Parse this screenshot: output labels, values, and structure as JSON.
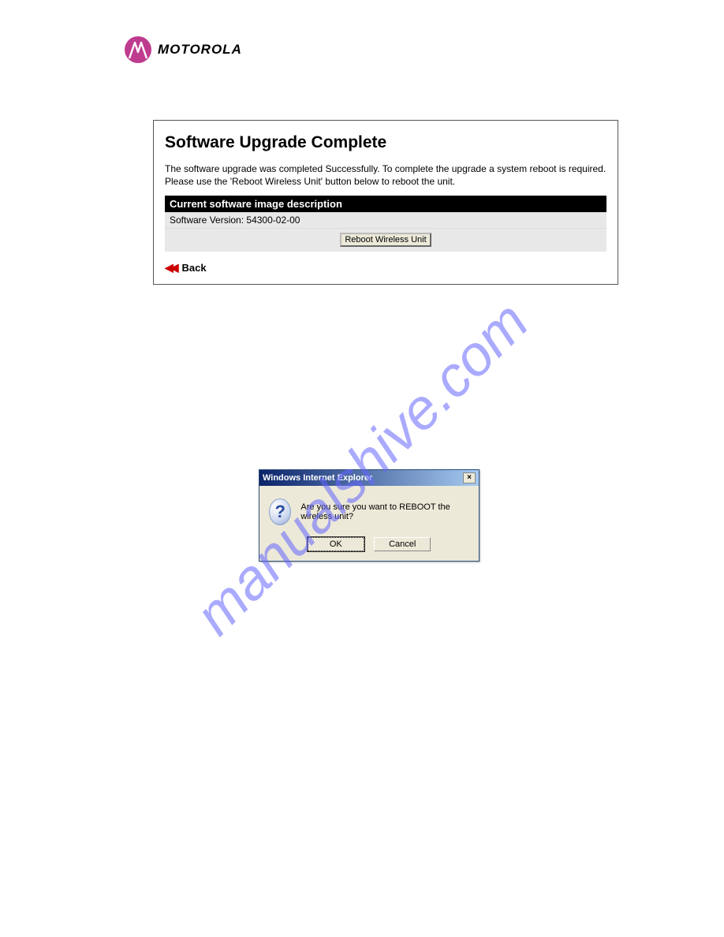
{
  "brand": {
    "name": "MOTOROLA"
  },
  "watermark": "manualshive.com",
  "panel": {
    "title": "Software Upgrade Complete",
    "description": "The software upgrade was completed Successfully. To complete the upgrade a system reboot is required. Please use the 'Reboot Wireless Unit' button below to reboot the unit.",
    "section_header": "Current software image description",
    "version_label": "Software Version:",
    "version_value": "54300-02-00",
    "reboot_button": "Reboot Wireless Unit",
    "back_label": "Back"
  },
  "dialog": {
    "title": "Windows Internet Explorer",
    "message": "Are you sure you want to REBOOT the wireless unit?",
    "ok": "OK",
    "cancel": "Cancel",
    "close": "×"
  }
}
